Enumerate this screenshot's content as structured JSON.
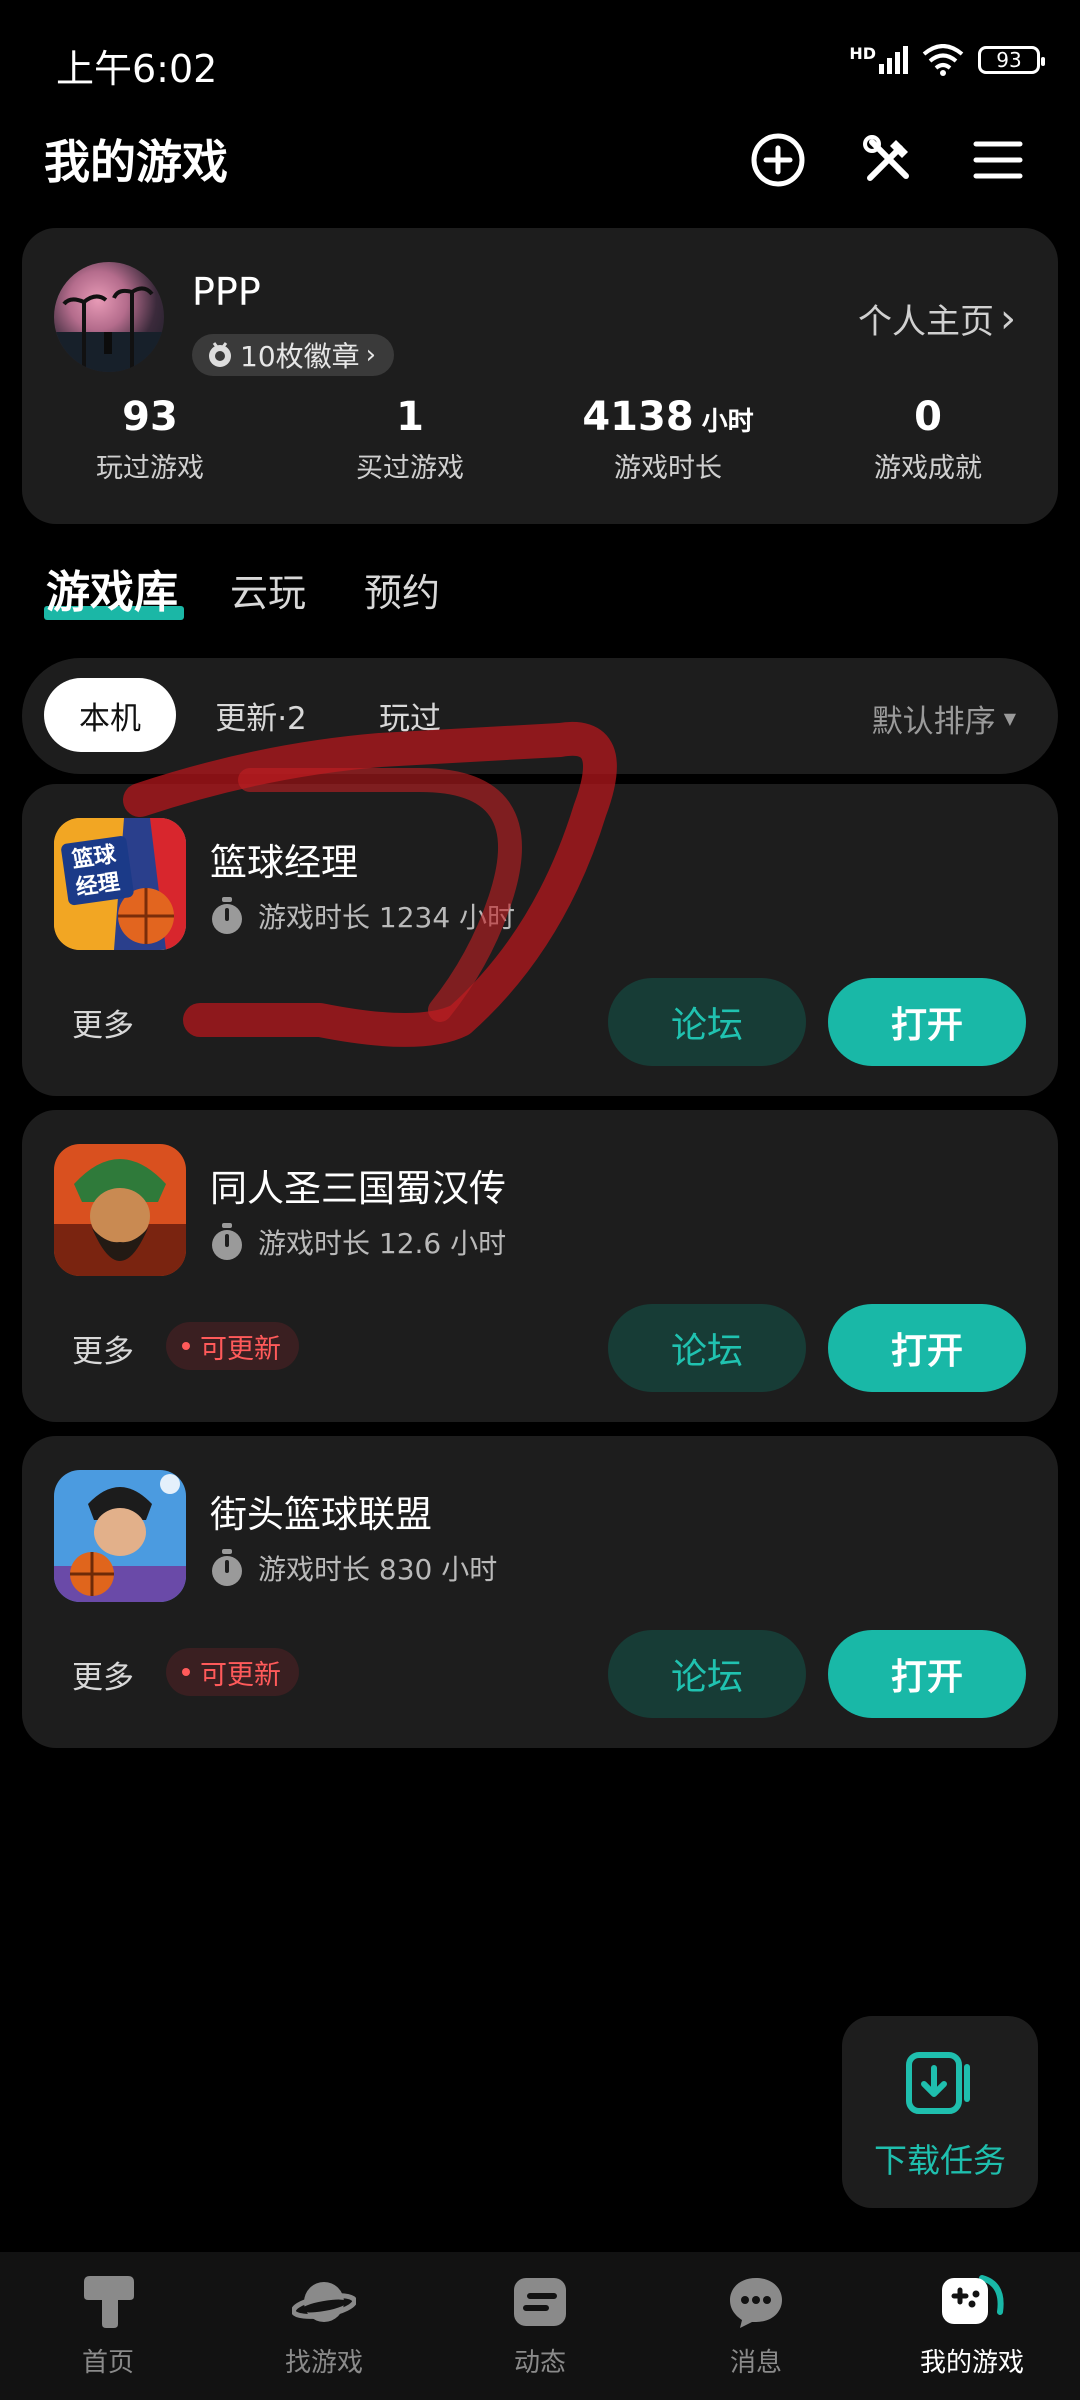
{
  "status_bar": {
    "time": "上午6:02",
    "battery": "93",
    "hd": "HD"
  },
  "header": {
    "title": "我的游戏",
    "icons": [
      "add-circle-icon",
      "tools-icon",
      "menu-icon"
    ]
  },
  "profile": {
    "username": "PPP",
    "badges": "10枚徽章",
    "homepage_link": "个人主页",
    "stats": [
      {
        "value": "93",
        "unit": "",
        "label": "玩过游戏"
      },
      {
        "value": "1",
        "unit": "",
        "label": "买过游戏"
      },
      {
        "value": "4138",
        "unit": "小时",
        "label": "游戏时长"
      },
      {
        "value": "0",
        "unit": "",
        "label": "游戏成就"
      }
    ]
  },
  "main_tabs": [
    {
      "label": "游戏库",
      "active": true
    },
    {
      "label": "云玩",
      "active": false
    },
    {
      "label": "预约",
      "active": false
    }
  ],
  "filters": {
    "chips": [
      {
        "label": "本机",
        "active": true
      },
      {
        "label": "更新·2",
        "active": false
      },
      {
        "label": "玩过",
        "active": false
      }
    ],
    "sort": "默认排序"
  },
  "games": [
    {
      "name": "篮球经理",
      "playtime": "游戏时长 1234 小时",
      "more": "更多",
      "update_tag": "",
      "forum": "论坛",
      "open": "打开",
      "icon_text": "篮球经理"
    },
    {
      "name": "同人圣三国蜀汉传",
      "playtime": "游戏时长 12.6 小时",
      "more": "更多",
      "update_tag": "可更新",
      "forum": "论坛",
      "open": "打开"
    },
    {
      "name": "街头篮球联盟",
      "playtime": "游戏时长 830 小时",
      "more": "更多",
      "update_tag": "可更新",
      "forum": "论坛",
      "open": "打开"
    }
  ],
  "download_task": {
    "label": "下载任务"
  },
  "bottom_nav": [
    {
      "label": "首页",
      "icon": "home-icon",
      "active": false
    },
    {
      "label": "找游戏",
      "icon": "planet-icon",
      "active": false
    },
    {
      "label": "动态",
      "icon": "feed-icon",
      "active": false
    },
    {
      "label": "消息",
      "icon": "message-icon",
      "active": false
    },
    {
      "label": "我的游戏",
      "icon": "gamepad-icon",
      "active": true
    }
  ],
  "colors": {
    "accent": "#19b8a7",
    "update_red": "#ff5a5a",
    "card_bg": "#1d1d1d"
  }
}
